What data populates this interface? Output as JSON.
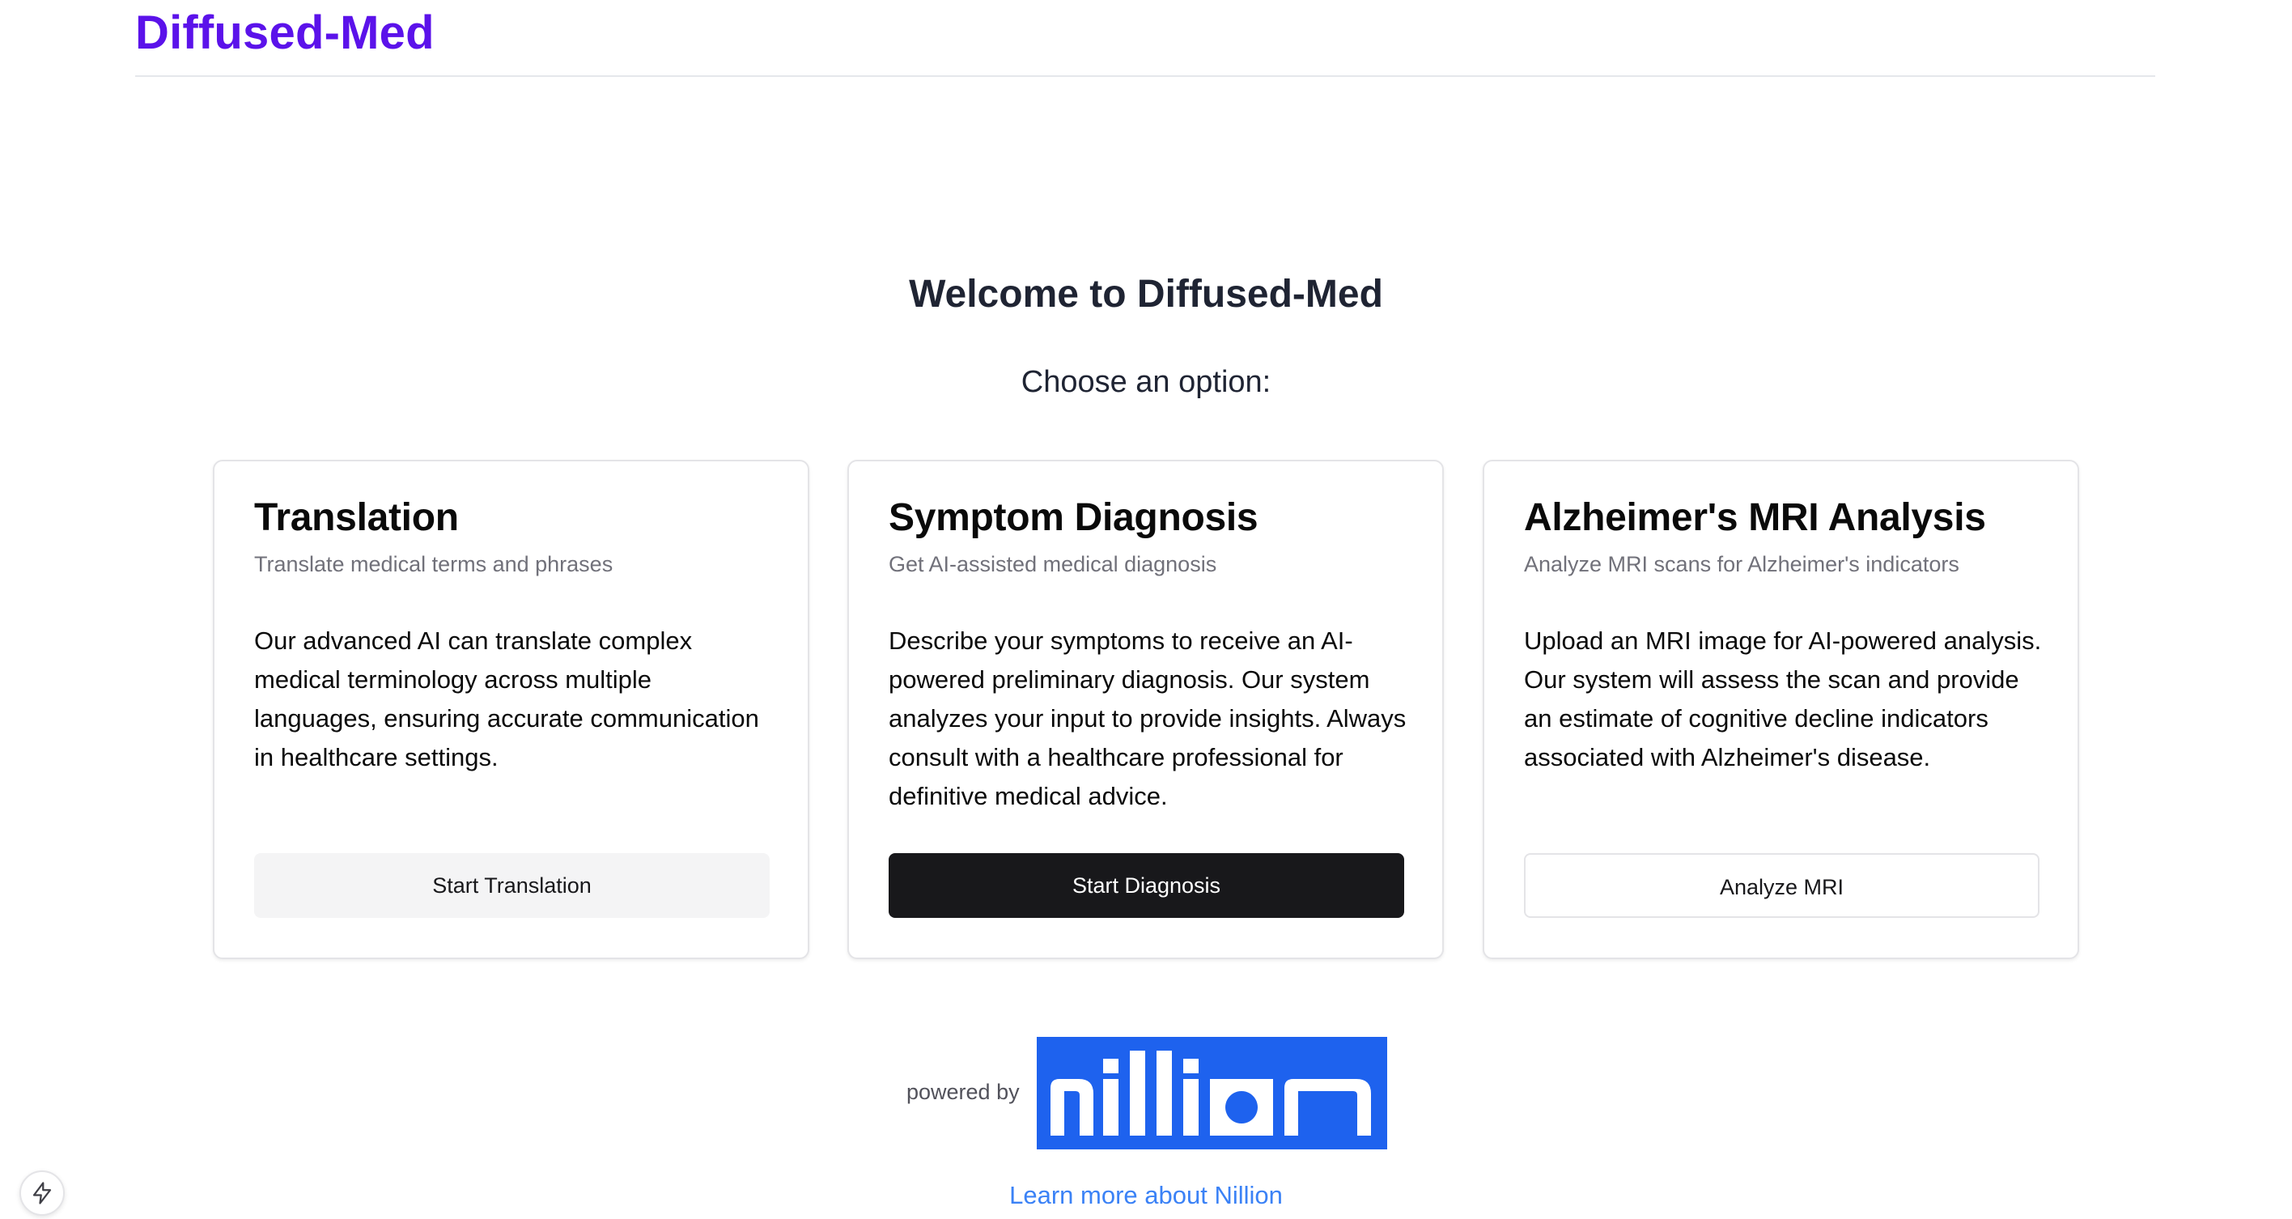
{
  "header": {
    "brand": "Diffused-Med"
  },
  "hero": {
    "title": "Welcome to Diffused-Med",
    "prompt": "Choose an option:"
  },
  "cards": [
    {
      "title": "Translation",
      "subtitle": "Translate medical terms and phrases",
      "body": "Our advanced AI can translate complex medical terminology across multiple languages, ensuring accurate communication in healthcare settings.",
      "button": "Start Translation"
    },
    {
      "title": "Symptom Diagnosis",
      "subtitle": "Get AI-assisted medical diagnosis",
      "body": "Describe your symptoms to receive an AI-powered preliminary diagnosis. Our system analyzes your input to provide insights. Always consult with a healthcare professional for definitive medical advice.",
      "button": "Start Diagnosis"
    },
    {
      "title": "Alzheimer's MRI Analysis",
      "subtitle": "Analyze MRI scans for Alzheimer's indicators",
      "body": "Upload an MRI image for AI-powered analysis. Our system will assess the scan and provide an estimate of cognitive decline indicators associated with Alzheimer's disease.",
      "button": "Analyze MRI"
    }
  ],
  "footer": {
    "powered_by": "powered by",
    "logo_text": "nillion",
    "logo_color": "#1e62ee",
    "learn_more": "Learn more about Nillion"
  },
  "icons": {
    "corner_badge": "lightning-bolt-icon"
  }
}
